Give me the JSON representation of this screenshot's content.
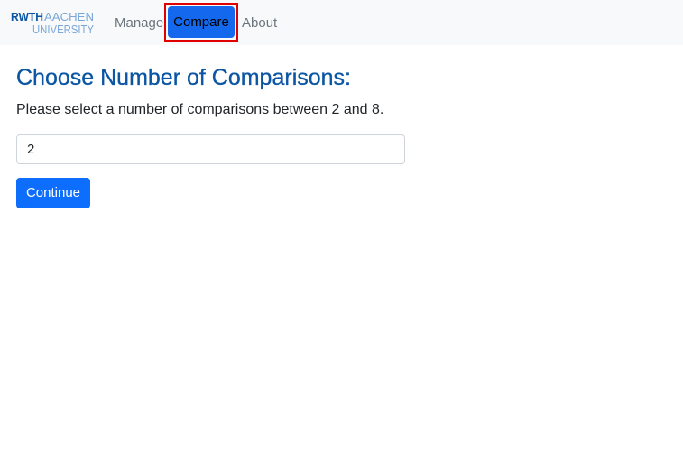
{
  "navbar": {
    "logo_text": "RWTH AACHEN UNIVERSITY",
    "items": [
      {
        "label": "Manage"
      },
      {
        "label": "Compare"
      },
      {
        "label": "About"
      }
    ]
  },
  "main": {
    "title": "Choose Number of Comparisons:",
    "description": "Please select a number of comparisons between 2 and 8.",
    "input_value": "2",
    "continue_label": "Continue"
  },
  "colors": {
    "active_nav": "#1468ee",
    "title": "#0b56a4",
    "primary_button": "#0d6efd",
    "highlight": "#e00000"
  }
}
